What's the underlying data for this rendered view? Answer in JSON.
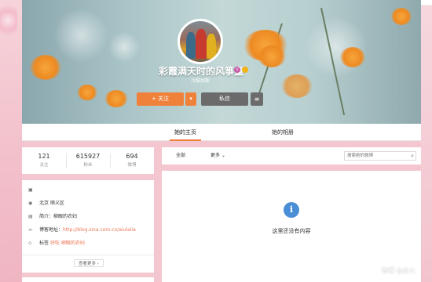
{
  "profile": {
    "name": "彩霞满天时的风箏童",
    "subtitle": "冷酷如斯",
    "badge": "V"
  },
  "actions": {
    "follow_label": "+ 关注",
    "follow_dropdown": "▾",
    "message_label": "私信",
    "more_label": "≡"
  },
  "tabs": [
    {
      "label": "她的主页"
    },
    {
      "label": "她的相册"
    }
  ],
  "stats": [
    {
      "value": "121",
      "label": "关注"
    },
    {
      "value": "615927",
      "label": "粉丝"
    },
    {
      "value": "694",
      "label": "微博"
    }
  ],
  "info": {
    "location": "北京 顺义区",
    "intro_label": "简介：",
    "intro_value": "柳眼的农妇",
    "blog_label": "博客地址：",
    "blog_value": "http://blog.sina.com.cn/aiulaiia",
    "tags_label": "标签",
    "tags_value": "好吃 柳眼的农妇",
    "more_label": "查看更多 ›"
  },
  "feed": {
    "filter_all": "全部",
    "filter_more": "更多 ⌄",
    "search_placeholder": "搜索她的微博",
    "empty_text": "这里还没有内容"
  },
  "watermark": "微博 @金火"
}
